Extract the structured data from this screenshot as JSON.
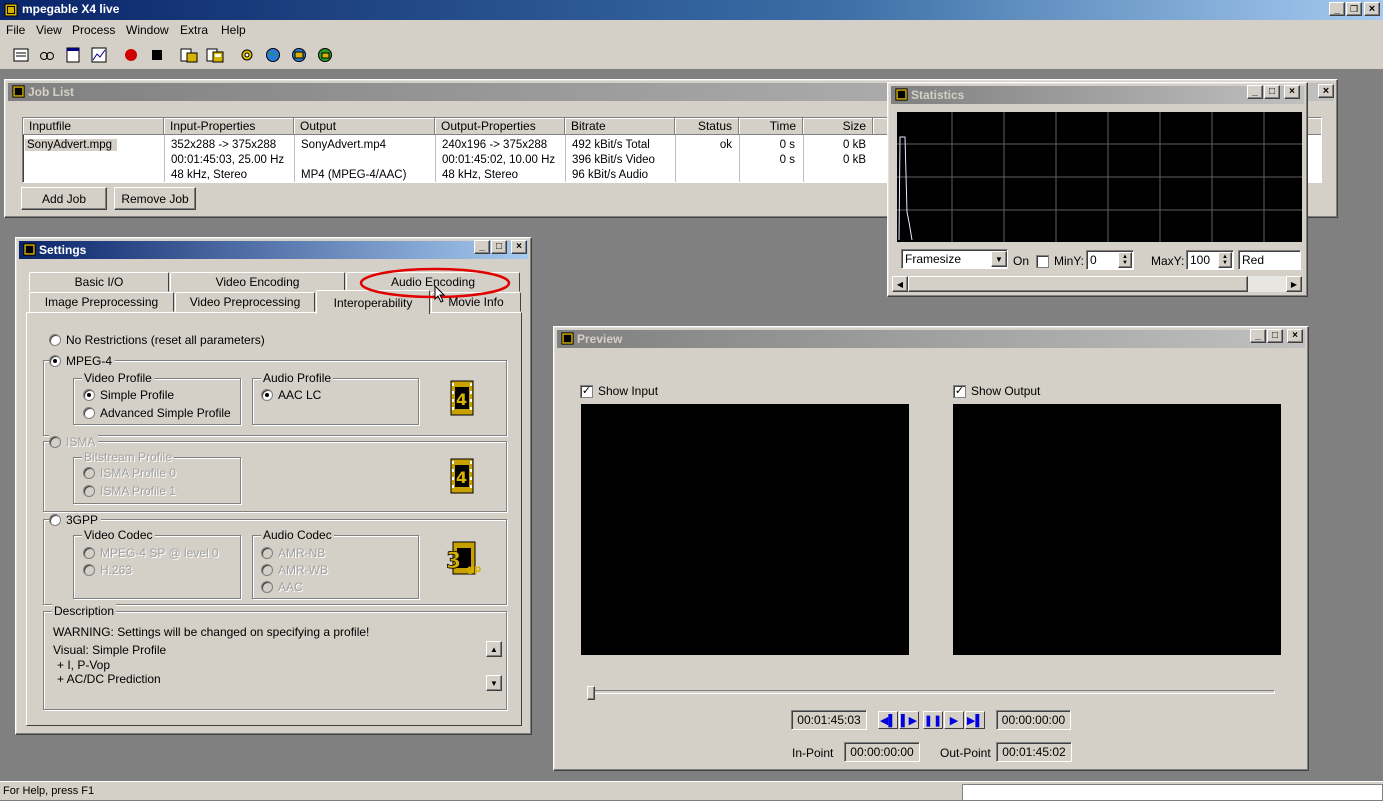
{
  "app": {
    "title": "mpegable X4 live"
  },
  "menu": [
    "File",
    "View",
    "Process",
    "Window",
    "Extra",
    "Help"
  ],
  "toolbar": {
    "icons": [
      "job-list-icon",
      "view-icon",
      "window-icon",
      "statistics-icon",
      "record-icon",
      "stop-icon",
      "open-icon",
      "save-icon",
      "settings-icon",
      "globe-icon",
      "globe-2-icon",
      "globe-3-icon"
    ]
  },
  "joblist": {
    "title": "Job List",
    "columns": [
      "Inputfile",
      "Input-Properties",
      "Output",
      "Output-Properties",
      "Bitrate",
      "Status",
      "Time",
      "Size"
    ],
    "rows": [
      [
        "SonyAdvert.mpg",
        "352x288 -> 375x288",
        "SonyAdvert.mp4",
        "240x196 -> 375x288",
        "492 kBit/s Total",
        "ok",
        "0 s",
        "0 kB"
      ],
      [
        "",
        "00:01:45:03, 25.00 Hz",
        "",
        "00:01:45:02, 10.00 Hz",
        "396 kBit/s Video",
        "",
        "0 s",
        "0 kB"
      ],
      [
        "",
        "48 kHz, Stereo",
        "MP4 (MPEG-4/AAC)",
        "48 kHz, Stereo",
        "96 kBit/s Audio",
        "",
        "",
        ""
      ]
    ],
    "add_job": "Add Job",
    "remove_job": "Remove Job"
  },
  "statistics": {
    "title": "Statistics",
    "metric": "Framesize",
    "on_label": "On",
    "miny_label": "MinY:",
    "miny_value": "0",
    "maxy_label": "MaxY:",
    "maxy_value": "100",
    "color": "Red"
  },
  "settings": {
    "title": "Settings",
    "tabs_top": [
      "Basic I/O",
      "Video Encoding",
      "Audio Encoding"
    ],
    "tabs_bottom": [
      "Image Preprocessing",
      "Video Preprocessing",
      "Interoperability",
      "Movie Info"
    ],
    "no_restrictions": "No Restrictions (reset all parameters)",
    "mpeg4": {
      "label": "MPEG-4",
      "video_profile_label": "Video Profile",
      "simple": "Simple Profile",
      "advanced": "Advanced Simple Profile",
      "audio_profile_label": "Audio Profile",
      "aac_lc": "AAC LC"
    },
    "isma": {
      "label": "ISMA",
      "bitstream_label": "Bitstream Profile",
      "profile0": "ISMA Profile 0",
      "profile1": "ISMA Profile 1"
    },
    "gpp": {
      "label": "3GPP",
      "video_codec_label": "Video Codec",
      "mpeg4sp": "MPEG-4 SP @ level 0",
      "h263": "H.263",
      "audio_codec_label": "Audio Codec",
      "amrnb": "AMR-NB",
      "amrwb": "AMR-WB",
      "aac": "AAC"
    },
    "description": {
      "label": "Description",
      "warning": "WARNING: Settings will be changed on specifying a profile!",
      "line1": "Visual: Simple Profile",
      "line2": "+ I, P-Vop",
      "line3": "+ AC/DC Prediction"
    }
  },
  "preview": {
    "title": "Preview",
    "show_input": "Show Input",
    "show_output": "Show Output",
    "current_time": "00:01:45:03",
    "end_time": "00:00:00:00",
    "in_point_label": "In-Point",
    "in_point": "00:00:00:00",
    "out_point_label": "Out-Point",
    "out_point": "00:01:45:02"
  },
  "statusbar": {
    "text": "For Help, press F1"
  },
  "colors": {
    "face": "#d4d0c8",
    "desktop": "#808080",
    "active_title": "#0a246a",
    "annotation": "#e00000"
  }
}
